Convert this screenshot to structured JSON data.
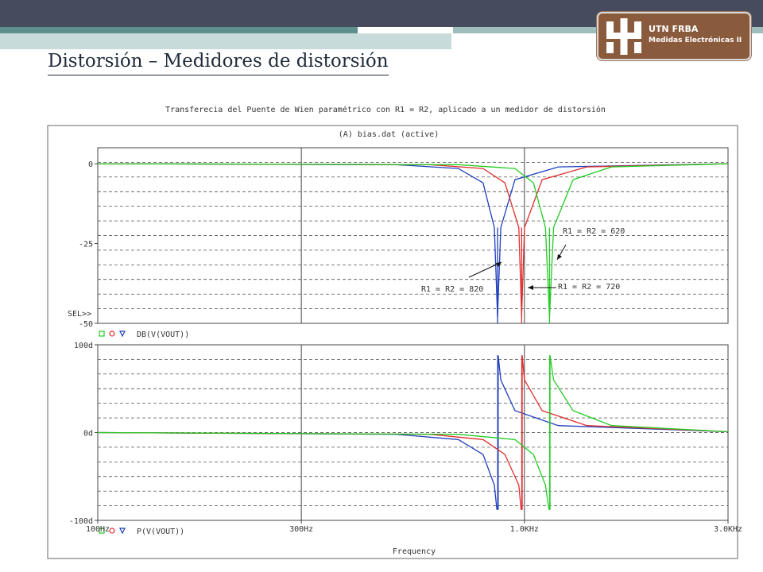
{
  "slide": {
    "title": "Distorsión – Medidores de distorsión"
  },
  "logo": {
    "line1": "UTN FRBA",
    "line2": "Medidas Electrónicas II"
  },
  "chart_data": {
    "type": "line",
    "title": "Transferecia del Puente de Wien  paramétrico con R1 = R2, aplicado a un medidor de distorsión",
    "subtitle": "(A) bias.dat (active)",
    "xlabel": "Frequency",
    "x_scale": "log",
    "xlim": [
      100,
      3000
    ],
    "x_ticks": [
      100,
      300,
      1000,
      3000
    ],
    "x_tick_labels": [
      "100Hz",
      "300Hz",
      "1.0KHz",
      "3.0KHz"
    ],
    "panels": [
      {
        "name": "magnitude",
        "ylim": [
          -50,
          5
        ],
        "y_ticks": [
          0,
          -25,
          -50
        ],
        "y_tick_labels": [
          "0",
          "-25",
          "-50"
        ],
        "sel_marker": "SEL>>",
        "legend": "DB(V(VOUT))",
        "series": [
          {
            "label": "R1 = R2 = 820",
            "color": "#1f3fbf",
            "notch_hz": 865,
            "points": [
              [
                100,
                0
              ],
              [
                500,
                -0.3
              ],
              [
                700,
                -1.5
              ],
              [
                800,
                -6
              ],
              [
                850,
                -20
              ],
              [
                865,
                -48
              ],
              [
                880,
                -20
              ],
              [
                950,
                -5
              ],
              [
                1200,
                -1
              ],
              [
                3000,
                0
              ]
            ]
          },
          {
            "label": "R1 = R2 = 720",
            "color": "#e03030",
            "notch_hz": 985,
            "points": [
              [
                100,
                0
              ],
              [
                600,
                -0.3
              ],
              [
                800,
                -1.5
              ],
              [
                900,
                -6
              ],
              [
                970,
                -20
              ],
              [
                985,
                -48
              ],
              [
                1000,
                -20
              ],
              [
                1100,
                -5
              ],
              [
                1400,
                -1
              ],
              [
                3000,
                0
              ]
            ]
          },
          {
            "label": "R1 = R2 = 620",
            "color": "#22cc22",
            "notch_hz": 1145,
            "points": [
              [
                100,
                0
              ],
              [
                700,
                -0.3
              ],
              [
                950,
                -1.5
              ],
              [
                1050,
                -6
              ],
              [
                1120,
                -20
              ],
              [
                1145,
                -48
              ],
              [
                1170,
                -20
              ],
              [
                1300,
                -5
              ],
              [
                1600,
                -1
              ],
              [
                3000,
                0
              ]
            ]
          }
        ],
        "annotations": [
          "R1 = R2 = 820",
          "R1 = R2 = 720",
          "R1 = R2 = 620"
        ]
      },
      {
        "name": "phase",
        "ylim": [
          -100,
          100
        ],
        "y_ticks": [
          100,
          0,
          -100
        ],
        "y_tick_labels": [
          "100d",
          "0d",
          "-100d"
        ],
        "legend": "P(V(VOUT))",
        "series": [
          {
            "color": "#1f3fbf",
            "notch_hz": 865,
            "points": [
              [
                100,
                0
              ],
              [
                500,
                -2
              ],
              [
                700,
                -8
              ],
              [
                800,
                -25
              ],
              [
                850,
                -60
              ],
              [
                862,
                -88
              ],
              [
                868,
                88
              ],
              [
                880,
                60
              ],
              [
                950,
                25
              ],
              [
                1200,
                8
              ],
              [
                3000,
                1
              ]
            ]
          },
          {
            "color": "#e03030",
            "notch_hz": 985,
            "points": [
              [
                100,
                0
              ],
              [
                600,
                -2
              ],
              [
                800,
                -8
              ],
              [
                900,
                -25
              ],
              [
                970,
                -60
              ],
              [
                982,
                -88
              ],
              [
                988,
                88
              ],
              [
                1000,
                60
              ],
              [
                1100,
                25
              ],
              [
                1400,
                8
              ],
              [
                3000,
                1
              ]
            ]
          },
          {
            "color": "#22cc22",
            "notch_hz": 1145,
            "points": [
              [
                100,
                0
              ],
              [
                700,
                -2
              ],
              [
                950,
                -8
              ],
              [
                1050,
                -25
              ],
              [
                1120,
                -60
              ],
              [
                1142,
                -88
              ],
              [
                1148,
                88
              ],
              [
                1170,
                60
              ],
              [
                1300,
                25
              ],
              [
                1600,
                8
              ],
              [
                3000,
                1
              ]
            ]
          }
        ]
      }
    ]
  }
}
